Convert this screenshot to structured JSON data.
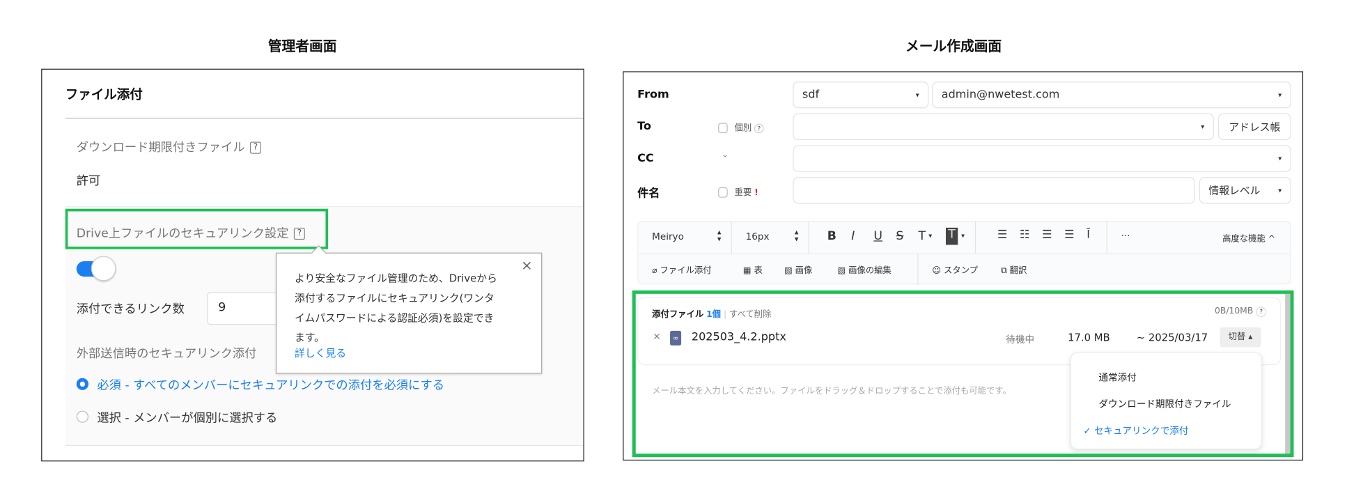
{
  "titles": {
    "admin": "管理者画面",
    "compose": "メール作成画面"
  },
  "admin": {
    "section_title": "ファイル添付",
    "download_label": "ダウンロード期限付きファイル",
    "help_glyph": "?",
    "download_value": "許可",
    "secure_link_label": "Drive上ファイルのセキュアリンク設定",
    "toggle_on": true,
    "link_count_label": "添付できるリンク数",
    "link_count_value": "9",
    "external_label": "外部送信時のセキュアリンク添付",
    "options": [
      {
        "label": "必須 - すべてのメンバーにセキュアリンクでの添付を必須にする",
        "selected": true
      },
      {
        "label": "選択 - メンバーが個別に選択する",
        "selected": false
      }
    ],
    "tooltip": {
      "lines": [
        "より安全なファイル管理のため、Driveから",
        "添付するファイルにセキュアリンク(ワンタ",
        "イムパスワードによる認証必須)を設定でき",
        "ます。"
      ],
      "link": "詳しく見る",
      "close": "×"
    }
  },
  "compose": {
    "from_label": "From",
    "from_name": "sdf",
    "from_email": "admin@nwetest.com",
    "to_label": "To",
    "individual": "個別",
    "help": "?",
    "address_book": "アドレス帳",
    "cc_label": "CC",
    "cc_chevron": "⌄",
    "subject_label": "件名",
    "important": "重要",
    "important_mark": "!",
    "info_level": "情報レベル",
    "caret": "▾",
    "toolbar": {
      "font": "Meiryo",
      "size": "16px",
      "bold": "B",
      "italic": "I",
      "underline": "U",
      "strike": "S",
      "textcolor": "T",
      "bgcolor": "T",
      "more": "···",
      "advanced": "高度な機能 ^",
      "attach": "ファイル添付",
      "table": "表",
      "image": "画像",
      "image_edit": "画像の編集",
      "stamp": "スタンプ",
      "translate": "翻訳"
    },
    "attachments": {
      "title": "添付ファイル",
      "count": "1個",
      "remove_all": "すべて削除",
      "quota": "0B/10MB",
      "file": {
        "remove": "×",
        "name": "202503_4.2.pptx",
        "status": "待機中",
        "size": "17.0 MB",
        "expiry": "~ 2025/03/17",
        "switch": "切替 ▴"
      }
    },
    "body_placeholder": "メール本文を入力してください。ファイルをドラッグ＆ドロップすることで添付も可能です。",
    "menu": [
      {
        "label": "通常添付",
        "selected": false
      },
      {
        "label": "ダウンロード期限付きファイル",
        "selected": false
      },
      {
        "label": "セキュアリンクで添付",
        "selected": true,
        "check": "✓"
      }
    ]
  },
  "colors": {
    "highlight": "#1fbf55",
    "accent": "#1a7ff0"
  }
}
